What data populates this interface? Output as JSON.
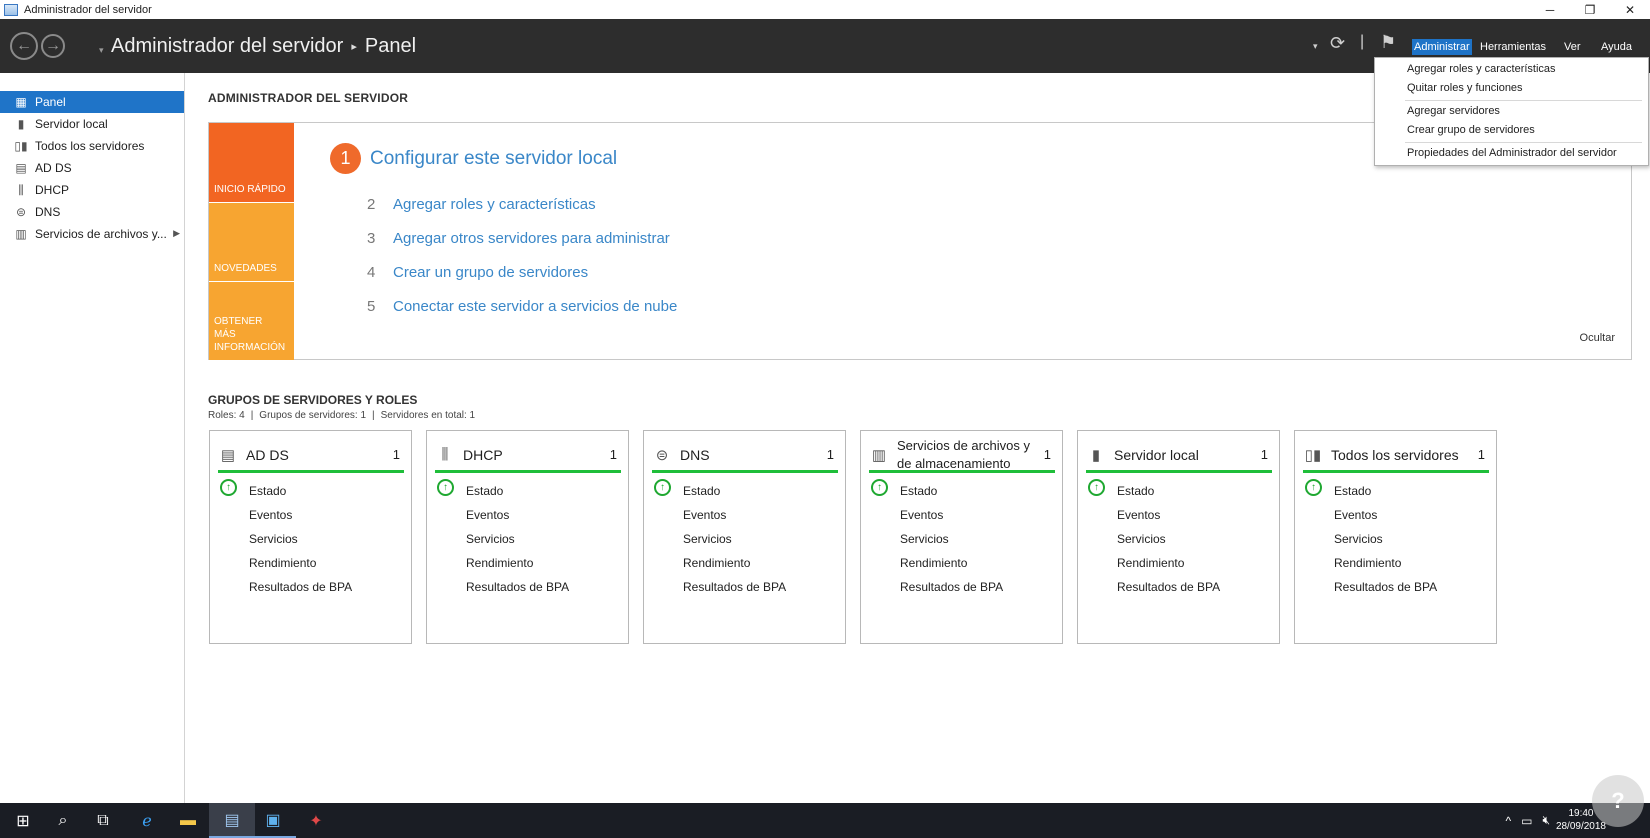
{
  "window": {
    "title": "Administrador del servidor",
    "minimize": "─",
    "maximize": "❐",
    "close": "✕"
  },
  "header": {
    "app_title": "Administrador del servidor",
    "separator": "▸",
    "page": "Panel",
    "menus": [
      "Administrar",
      "Herramientas",
      "Ver",
      "Ayuda"
    ],
    "active_menu": "Administrar"
  },
  "sidebar": {
    "items": [
      {
        "label": "Panel",
        "icon": "dashboard-icon"
      },
      {
        "label": "Servidor local",
        "icon": "server-icon"
      },
      {
        "label": "Todos los servidores",
        "icon": "servers-icon"
      },
      {
        "label": "AD DS",
        "icon": "ad-ds-icon"
      },
      {
        "label": "DHCP",
        "icon": "dhcp-icon"
      },
      {
        "label": "DNS",
        "icon": "dns-icon"
      },
      {
        "label": "Servicios de archivos y...",
        "icon": "file-services-icon"
      }
    ]
  },
  "main": {
    "heading": "ADMINISTRADOR DEL SERVIDOR",
    "quick_start": {
      "tabs": [
        "INICIO RÁPIDO",
        "NOVEDADES",
        "OBTENER MÁS INFORMACIÓN"
      ],
      "tab_colors": [
        "#f26522",
        "#f7a531",
        "#f7a531"
      ],
      "step1": {
        "num": "1",
        "label": "Configurar este servidor local"
      },
      "steps": [
        {
          "num": "2",
          "label": "Agregar roles y características"
        },
        {
          "num": "3",
          "label": "Agregar otros servidores para administrar"
        },
        {
          "num": "4",
          "label": "Crear un grupo de servidores"
        },
        {
          "num": "5",
          "label": "Conectar este servidor a servicios de nube"
        }
      ],
      "hide": "Ocultar"
    },
    "groups": {
      "title": "GRUPOS DE SERVIDORES Y ROLES",
      "roles": "Roles: 4",
      "server_groups": "Grupos de servidores: 1",
      "total_servers": "Servidores en total: 1",
      "rows": [
        "Estado",
        "Eventos",
        "Servicios",
        "Rendimiento",
        "Resultados de BPA"
      ],
      "tiles": [
        {
          "name": "AD DS",
          "count": "1",
          "icon": "ad-ds-icon"
        },
        {
          "name": "DHCP",
          "count": "1",
          "icon": "dhcp-icon"
        },
        {
          "name": "DNS",
          "count": "1",
          "icon": "dns-icon"
        },
        {
          "name": "Servicios de archivos y de almacenamiento",
          "count": "1",
          "icon": "file-services-icon"
        },
        {
          "name": "Servidor local",
          "count": "1",
          "icon": "server-icon"
        },
        {
          "name": "Todos los servidores",
          "count": "1",
          "icon": "servers-icon"
        }
      ]
    }
  },
  "dropdown": {
    "items": [
      "Agregar roles y características",
      "Quitar roles y funciones",
      "Agregar servidores",
      "Crear grupo de servidores",
      "Propiedades del Administrador del servidor"
    ]
  },
  "taskbar": {
    "time": "19:40",
    "date": "28/09/2018"
  },
  "colors": {
    "accent": "#1f74c8",
    "status_ok": "#1fbe3a",
    "link": "#3a87c8"
  }
}
